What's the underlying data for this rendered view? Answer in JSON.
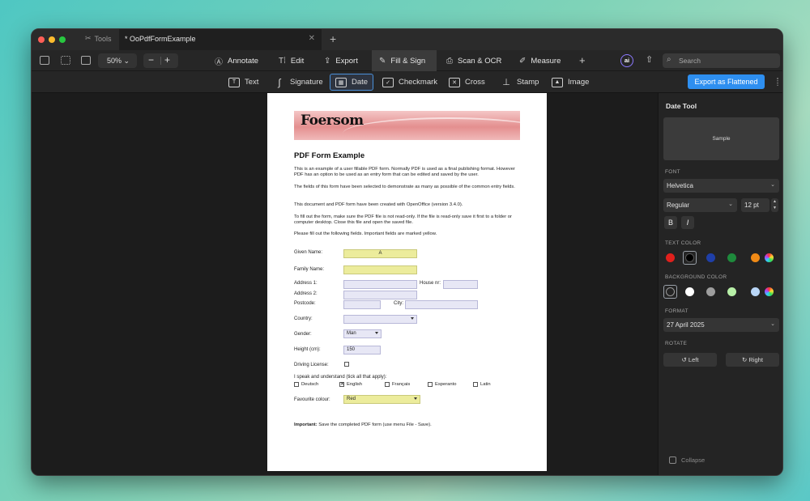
{
  "window": {
    "tools_tab": "Tools",
    "doc_tab": "* OoPdfFormExample"
  },
  "toolbar": {
    "zoom": "50%",
    "menu": [
      {
        "label": "Annotate",
        "icon": "annotate-icon"
      },
      {
        "label": "Edit",
        "icon": "edit-icon"
      },
      {
        "label": "Export",
        "icon": "export-icon"
      },
      {
        "label": "Fill & Sign",
        "icon": "fill-sign-icon",
        "active": true
      },
      {
        "label": "Scan & OCR",
        "icon": "scan-icon"
      },
      {
        "label": "Measure",
        "icon": "measure-icon"
      }
    ],
    "ai": "ai",
    "search_placeholder": "Search"
  },
  "subbar": {
    "items": [
      {
        "label": "Text",
        "icon": "text-icon"
      },
      {
        "label": "Signature",
        "icon": "signature-icon"
      },
      {
        "label": "Date",
        "icon": "calendar-icon",
        "active": true
      },
      {
        "label": "Checkmark",
        "icon": "checkmark-icon"
      },
      {
        "label": "Cross",
        "icon": "cross-icon"
      },
      {
        "label": "Stamp",
        "icon": "stamp-icon"
      },
      {
        "label": "Image",
        "icon": "image-icon"
      }
    ],
    "export_label": "Export as Flattened"
  },
  "pdf": {
    "logo": "Foersom",
    "heading": "PDF Form Example",
    "paragraphs": [
      "This is an example of a user fillable PDF form. Normally PDF is used as a final publishing format. However PDF has an option to be used as an entry form that can be edited and saved by the user.",
      "The fields of this form have been selected to demonstrate as many as possible of the common entry fields.",
      "This document and PDF form have been created with OpenOffice (version 3.4.0).",
      "To fill out the form, make sure the PDF file is not read-only. If the file is read-only save it first to a folder or computer desktop. Close this file and open the saved file.",
      "Please fill out the following fields. Important fields are marked yellow."
    ],
    "labels": {
      "given_name": "Given Name:",
      "family_name": "Family Name:",
      "address1": "Address 1:",
      "house_nr": "House nr:",
      "address2": "Address 2:",
      "postcode": "Postcode:",
      "city": "City:",
      "country": "Country:",
      "gender": "Gender:",
      "height": "Height (cm):",
      "driving": "Driving License:",
      "languages_intro": "I speak and understand (tick all that apply):",
      "fav_colour": "Favourite colour:"
    },
    "values": {
      "given_name": "A",
      "gender": "Man",
      "height": "150",
      "fav_colour": "Red"
    },
    "languages": [
      {
        "label": "Deutsch",
        "checked": false
      },
      {
        "label": "English",
        "checked": true
      },
      {
        "label": "Français",
        "checked": false
      },
      {
        "label": "Esperanto",
        "checked": false
      },
      {
        "label": "Latin",
        "checked": false
      }
    ],
    "footer_bold": "Important:",
    "footer_text": " Save the completed PDF form (use menu File - Save)."
  },
  "panel": {
    "title": "Date Tool",
    "sample": "Sample",
    "font_label": "FONT",
    "font": "Helvetica",
    "style": "Regular",
    "size": "12 pt",
    "bold": "B",
    "italic": "I",
    "text_color_label": "TEXT COLOR",
    "text_colors": [
      "#e0201c",
      "#000000",
      "#1f3fa8",
      "#1e8a3c",
      "#f08a16"
    ],
    "bg_color_label": "BACKGROUND COLOR",
    "bg_colors": [
      "#ffffff",
      "#9e9e9e",
      "#b8f0a8",
      "#b9d6f7"
    ],
    "format_label": "FORMAT",
    "format": "27 April 2025",
    "rotate_label": "ROTATE",
    "rotate_left": "Left",
    "rotate_right": "Right",
    "collapse": "Collapse"
  }
}
